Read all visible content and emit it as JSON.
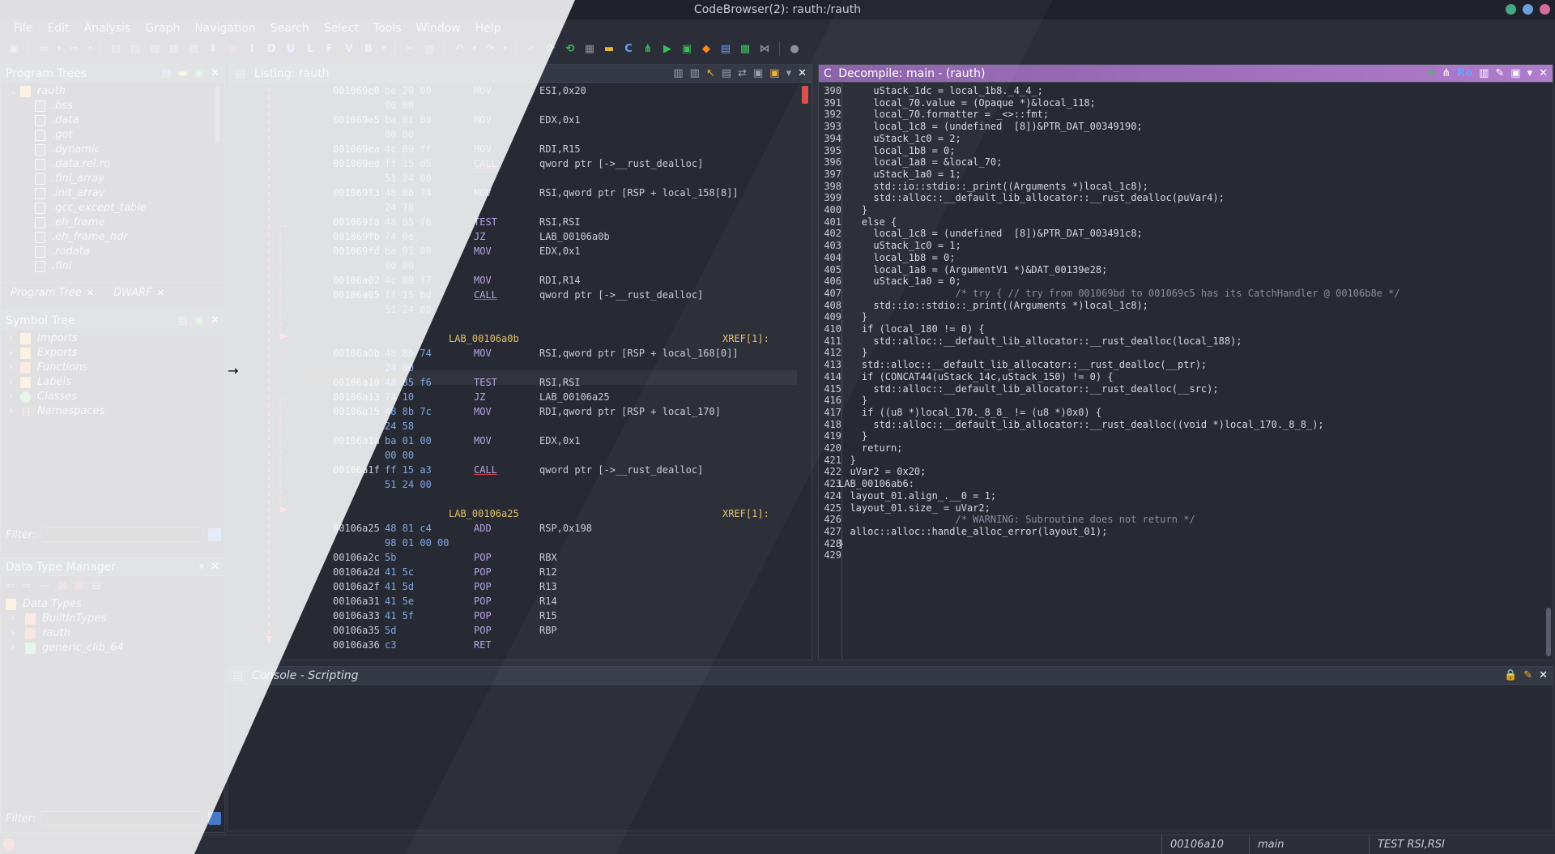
{
  "window": {
    "title": "CodeBrowser(2): rauth:/rauth",
    "colors": {
      "dot1": "#46a884",
      "dot2": "#6aa0d6",
      "dot3": "#d46b9a"
    }
  },
  "menu": [
    "File",
    "Edit",
    "Analysis",
    "Graph",
    "Navigation",
    "Search",
    "Select",
    "Tools",
    "Window",
    "Help"
  ],
  "toolbar_letters": [
    "I",
    "D",
    "U",
    "L",
    "F",
    "V",
    "B"
  ],
  "program_trees": {
    "title": "Program Trees",
    "root": "rauth",
    "items": [
      ".bss",
      ".data",
      ".got",
      ".dynamic",
      ".data.rel.ro",
      ".fini_array",
      ".init_array",
      ".gcc_except_table",
      ".eh_frame",
      ".eh_frame_hdr",
      ".rodata",
      ".fini"
    ],
    "tabs": [
      "Program Tree",
      "DWARF"
    ]
  },
  "symbol_tree": {
    "title": "Symbol Tree",
    "items": [
      "Imports",
      "Exports",
      "Functions",
      "Labels",
      "Classes",
      "Namespaces"
    ],
    "filter_label": "Filter:"
  },
  "data_type_manager": {
    "title": "Data Type Manager",
    "root": "Data Types",
    "items": [
      "BuiltInTypes",
      "rauth",
      "generic_clib_64"
    ],
    "filter_label": "Filter:"
  },
  "listing": {
    "title": "Listing:  rauth",
    "rows": [
      {
        "addr": "001069e0",
        "bytes": "be 20 00",
        "mnem": "MOV",
        "ops": "ESI,0x20"
      },
      {
        "addr": "",
        "bytes": "00 00",
        "mnem": "",
        "ops": ""
      },
      {
        "addr": "001069e5",
        "bytes": "ba 01 00",
        "mnem": "MOV",
        "ops": "EDX,0x1"
      },
      {
        "addr": "",
        "bytes": "00 00",
        "mnem": "",
        "ops": ""
      },
      {
        "addr": "001069ea",
        "bytes": "4c 89 ff",
        "mnem": "MOV",
        "ops": "RDI,R15"
      },
      {
        "addr": "001069ed",
        "bytes": "ff 15 d5",
        "mnem": "CALL",
        "ops": "qword ptr [->__rust_dealloc]"
      },
      {
        "addr": "",
        "bytes": "51 24 00",
        "mnem": "",
        "ops": ""
      },
      {
        "addr": "001069f3",
        "bytes": "48 8b 74",
        "mnem": "MOV",
        "ops": "RSI,qword ptr [RSP + local_158[8]]"
      },
      {
        "addr": "",
        "bytes": "24 78",
        "mnem": "",
        "ops": ""
      },
      {
        "addr": "001069f8",
        "bytes": "48 85 f6",
        "mnem": "TEST",
        "ops": "RSI,RSI"
      },
      {
        "addr": "001069fb",
        "bytes": "74 0e",
        "mnem": "JZ",
        "ops": "LAB_00106a0b"
      },
      {
        "addr": "001069fd",
        "bytes": "ba 01 00",
        "mnem": "MOV",
        "ops": "EDX,0x1"
      },
      {
        "addr": "",
        "bytes": "00 00",
        "mnem": "",
        "ops": ""
      },
      {
        "addr": "00106a02",
        "bytes": "4c 89 f7",
        "mnem": "MOV",
        "ops": "RDI,R14"
      },
      {
        "addr": "00106a05",
        "bytes": "ff 15 bd",
        "mnem": "CALL",
        "ops": "qword ptr [->__rust_dealloc]"
      },
      {
        "addr": "",
        "bytes": "51 24 00",
        "mnem": "",
        "ops": ""
      },
      {
        "addr": "",
        "bytes": "",
        "mnem": "",
        "ops": ""
      },
      {
        "label": "LAB_00106a0b",
        "xref": "XREF[1]:"
      },
      {
        "addr": "00106a0b",
        "bytes": "48 8b 74",
        "mnem": "MOV",
        "ops": "RSI,qword ptr [RSP + local_168[0]]"
      },
      {
        "addr": "",
        "bytes": "24 60",
        "mnem": "",
        "ops": ""
      },
      {
        "addr": "00106a10",
        "bytes": "48 85 f6",
        "mnem": "TEST",
        "ops": "RSI,RSI"
      },
      {
        "addr": "00106a13",
        "bytes": "74 10",
        "mnem": "JZ",
        "ops": "LAB_00106a25"
      },
      {
        "addr": "00106a15",
        "bytes": "48 8b 7c",
        "mnem": "MOV",
        "ops": "RDI,qword ptr [RSP + local_170]"
      },
      {
        "addr": "",
        "bytes": "24 58",
        "mnem": "",
        "ops": ""
      },
      {
        "addr": "00106a1a",
        "bytes": "ba 01 00",
        "mnem": "MOV",
        "ops": "EDX,0x1"
      },
      {
        "addr": "",
        "bytes": "00 00",
        "mnem": "",
        "ops": ""
      },
      {
        "addr": "00106a1f",
        "bytes": "ff 15 a3",
        "mnem": "CALL",
        "ops": "qword ptr [->__rust_dealloc]"
      },
      {
        "addr": "",
        "bytes": "51 24 00",
        "mnem": "",
        "ops": ""
      },
      {
        "addr": "",
        "bytes": "",
        "mnem": "",
        "ops": ""
      },
      {
        "label": "LAB_00106a25",
        "xref": "XREF[1]:"
      },
      {
        "addr": "00106a25",
        "bytes": "48 81 c4",
        "mnem": "ADD",
        "ops": "RSP,0x198"
      },
      {
        "addr": "",
        "bytes": "98 01 00 00",
        "mnem": "",
        "ops": ""
      },
      {
        "addr": "00106a2c",
        "bytes": "5b",
        "mnem": "POP",
        "ops": "RBX"
      },
      {
        "addr": "00106a2d",
        "bytes": "41 5c",
        "mnem": "POP",
        "ops": "R12"
      },
      {
        "addr": "00106a2f",
        "bytes": "41 5d",
        "mnem": "POP",
        "ops": "R13"
      },
      {
        "addr": "00106a31",
        "bytes": "41 5e",
        "mnem": "POP",
        "ops": "R14"
      },
      {
        "addr": "00106a33",
        "bytes": "41 5f",
        "mnem": "POP",
        "ops": "R15"
      },
      {
        "addr": "00106a35",
        "bytes": "5d",
        "mnem": "POP",
        "ops": "RBP"
      },
      {
        "addr": "00106a36",
        "bytes": "c3",
        "mnem": "RET",
        "ops": ""
      }
    ]
  },
  "decompile": {
    "title": "Decompile: main -  (rauth)",
    "ro_label": "Ro",
    "lines": [
      {
        "n": "390",
        "code": "      uStack_1dc = local_1b8._4_4_;"
      },
      {
        "n": "391",
        "code": "      local_70.value = (Opaque *)&local_118;"
      },
      {
        "n": "392",
        "code": "      local_70.formatter = _<>::fmt;"
      },
      {
        "n": "393",
        "code": "      local_1c8 = (undefined  [8])&PTR_DAT_00349190;"
      },
      {
        "n": "394",
        "code": "      uStack_1c0 = 2;"
      },
      {
        "n": "395",
        "code": "      local_1b8 = 0;"
      },
      {
        "n": "396",
        "code": "      local_1a8 = &local_70;"
      },
      {
        "n": "397",
        "code": "      uStack_1a0 = 1;"
      },
      {
        "n": "398",
        "code": "      std::io::stdio::_print((Arguments *)local_1c8);"
      },
      {
        "n": "399",
        "code": "      std::alloc::__default_lib_allocator::__rust_dealloc(puVar4);"
      },
      {
        "n": "400",
        "code": "    }"
      },
      {
        "n": "401",
        "code": "    else {"
      },
      {
        "n": "402",
        "code": "      local_1c8 = (undefined  [8])&PTR_DAT_003491c8;"
      },
      {
        "n": "403",
        "code": "      uStack_1c0 = 1;"
      },
      {
        "n": "404",
        "code": "      local_1b8 = 0;"
      },
      {
        "n": "405",
        "code": "      local_1a8 = (ArgumentV1 *)&DAT_00139e28;"
      },
      {
        "n": "406",
        "code": "      uStack_1a0 = 0;"
      },
      {
        "n": "407",
        "code": "                    /* try { // try from 001069bd to 001069c5 has its CatchHandler @ 00106b8e */"
      },
      {
        "n": "408",
        "code": "      std::io::stdio::_print((Arguments *)local_1c8);"
      },
      {
        "n": "409",
        "code": "    }"
      },
      {
        "n": "410",
        "code": "    if (local_180 != 0) {"
      },
      {
        "n": "411",
        "code": "      std::alloc::__default_lib_allocator::__rust_dealloc(local_188);"
      },
      {
        "n": "412",
        "code": "    }"
      },
      {
        "n": "413",
        "code": "    std::alloc::__default_lib_allocator::__rust_dealloc(__ptr);"
      },
      {
        "n": "414",
        "code": "    if (CONCAT44(uStack_14c,uStack_150) != 0) {"
      },
      {
        "n": "415",
        "code": "      std::alloc::__default_lib_allocator::__rust_dealloc(__src);"
      },
      {
        "n": "416",
        "code": "    }"
      },
      {
        "n": "417",
        "code": "    if ((u8 *)local_170._8_8_ != (u8 *)0x0) {"
      },
      {
        "n": "418",
        "code": "      std::alloc::__default_lib_allocator::__rust_dealloc((void *)local_170._8_8_);"
      },
      {
        "n": "419",
        "code": "    }"
      },
      {
        "n": "420",
        "code": "    return;"
      },
      {
        "n": "421",
        "code": "  }"
      },
      {
        "n": "422",
        "code": "  uVar2 = 0x20;"
      },
      {
        "n": "423",
        "code": "LAB_00106ab6:"
      },
      {
        "n": "424",
        "code": "  layout_01.align_.__0 = 1;"
      },
      {
        "n": "425",
        "code": "  layout_01.size_ = uVar2;"
      },
      {
        "n": "426",
        "code": "                    /* WARNING: Subroutine does not return */"
      },
      {
        "n": "427",
        "code": "  alloc::alloc::handle_alloc_error(layout_01);"
      },
      {
        "n": "428",
        "code": "}"
      },
      {
        "n": "429",
        "code": ""
      }
    ]
  },
  "console": {
    "title": "Console - Scripting"
  },
  "status": {
    "address": "00106a10",
    "function": "main",
    "instruction": "TEST RSI,RSI"
  }
}
